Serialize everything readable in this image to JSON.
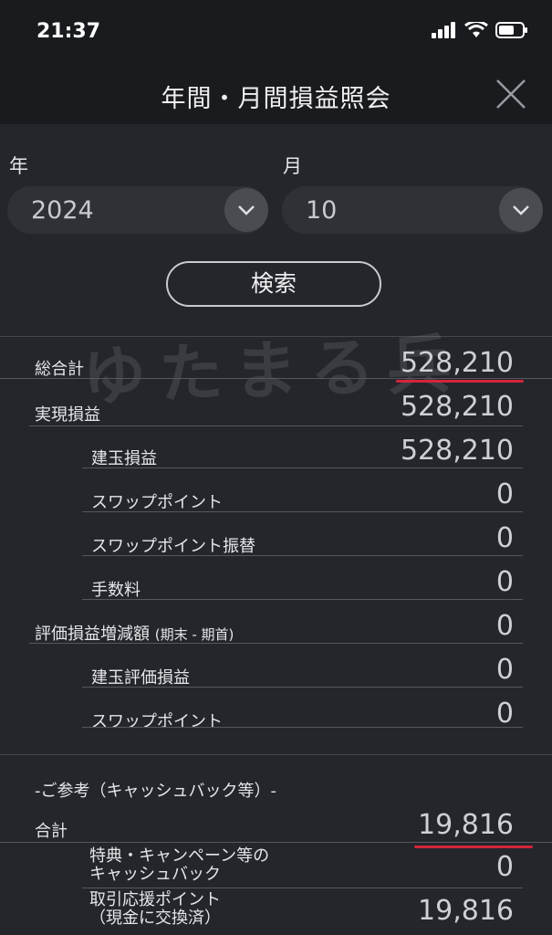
{
  "status": {
    "time": "21:37"
  },
  "header": {
    "title": "年間・月間損益照会"
  },
  "filters": {
    "year_label": "年",
    "year_value": "2024",
    "month_label": "月",
    "month_value": "10",
    "search_label": "検索"
  },
  "watermark": "ゆたまる兵",
  "summary": {
    "total_label": "総合計",
    "total_value": "528,210",
    "rows": [
      {
        "label": "実現損益",
        "value": "528,210"
      },
      {
        "label": "建玉損益",
        "value": "528,210"
      },
      {
        "label": "スワップポイント",
        "value": "0"
      },
      {
        "label": "スワップポイント振替",
        "value": "0"
      },
      {
        "label": "手数料",
        "value": "0"
      },
      {
        "label": "評価損益増減額",
        "label_sub": "(期末 - 期首)",
        "value": "0"
      },
      {
        "label": "建玉評価損益",
        "value": "0"
      },
      {
        "label": "スワップポイント",
        "value": "0"
      }
    ]
  },
  "reference": {
    "heading": "-ご参考（キャッシュバック等）-",
    "total_label": "合計",
    "total_value": "19,816",
    "rows": [
      {
        "label_line1": "特典・キャンペーン等の",
        "label_line2": "キャッシュバック",
        "value": "0"
      },
      {
        "label_line1": "取引応援ポイント",
        "label_line2": "（現金に交換済）",
        "value": "19,816"
      }
    ]
  },
  "colors": {
    "accent_red": "#d3243a",
    "background": "#24262c",
    "header": "#1a1b1f"
  }
}
